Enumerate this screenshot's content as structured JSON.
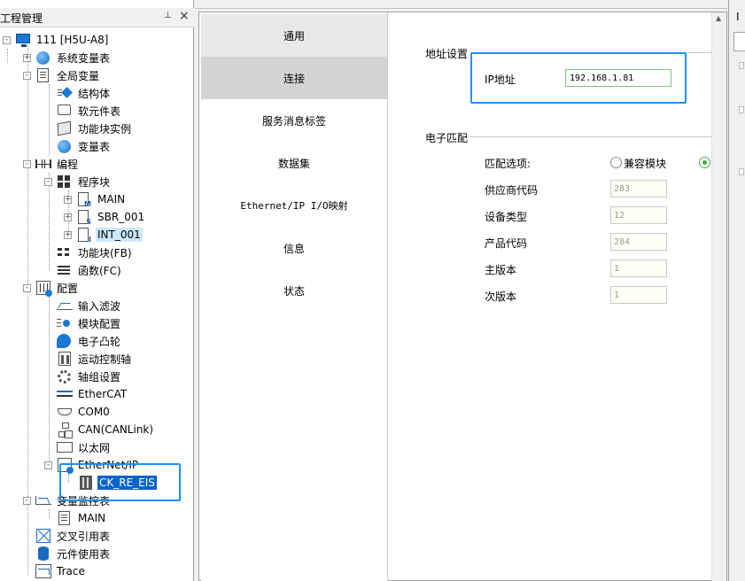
{
  "project_pane": {
    "title": "工程管理",
    "pin_glyph": "⊥",
    "close_glyph": "×"
  },
  "tree": [
    {
      "label": "111 [H5U-A8]",
      "icon": "monitor-icon",
      "expander": "-"
    },
    {
      "label": "系统变量表",
      "icon": "globe-icon",
      "expander": "+"
    },
    {
      "label": "全局变量",
      "icon": "document-icon",
      "expander": "-"
    },
    {
      "label": "结构体",
      "icon": "struct-icon"
    },
    {
      "label": "软元件表",
      "icon": "chat-icon"
    },
    {
      "label": "功能块实例",
      "icon": "box-icon"
    },
    {
      "label": "变量表",
      "icon": "globe-icon"
    },
    {
      "label": "编程",
      "icon": "ladder-icon",
      "expander": "-"
    },
    {
      "label": "程序块",
      "icon": "grid-icon",
      "expander": "-"
    },
    {
      "label": "MAIN",
      "icon": "program-icon",
      "expander": "+"
    },
    {
      "label": "SBR_001",
      "icon": "program-icon",
      "expander": "+"
    },
    {
      "label": "INT_001",
      "icon": "program-icon",
      "expander": "+"
    },
    {
      "label": "功能块(FB)",
      "icon": "function-block-icon"
    },
    {
      "label": "函数(FC)",
      "icon": "function-icon"
    },
    {
      "label": "配置",
      "icon": "config-icon",
      "expander": "-"
    },
    {
      "label": "输入滤波",
      "icon": "wave-icon"
    },
    {
      "label": "模块配置",
      "icon": "module-icon"
    },
    {
      "label": "电子凸轮",
      "icon": "cam-icon"
    },
    {
      "label": "运动控制轴",
      "icon": "axis-icon"
    },
    {
      "label": "轴组设置",
      "icon": "gear-icon"
    },
    {
      "label": "EtherCAT",
      "icon": "ethercat-icon"
    },
    {
      "label": "COM0",
      "icon": "serial-port-icon"
    },
    {
      "label": "CAN(CANLink)",
      "icon": "network-icon"
    },
    {
      "label": "以太网",
      "icon": "ethernet-icon"
    },
    {
      "label": "EtherNet/IP",
      "icon": "ethernet-ip-icon",
      "expander": "-"
    },
    {
      "label": "CK_RE_EIS",
      "icon": "device-icon"
    },
    {
      "label": "变量监控表",
      "icon": "monitor-chart-icon",
      "expander": "-"
    },
    {
      "label": "MAIN",
      "icon": "document-icon"
    },
    {
      "label": "交叉引用表",
      "icon": "cross-reference-icon"
    },
    {
      "label": "元件使用表",
      "icon": "database-icon"
    },
    {
      "label": "Trace",
      "icon": "trace-icon"
    }
  ],
  "nav": [
    {
      "label": "通用"
    },
    {
      "label": "连接"
    },
    {
      "label": "服务消息标签"
    },
    {
      "label": "数据集"
    },
    {
      "label": "Ethernet/IP I/O映射"
    },
    {
      "label": "信息"
    },
    {
      "label": "状态"
    }
  ],
  "address": {
    "title": "地址设置",
    "ip_label": "IP地址",
    "ip_value": "192.168.1.81"
  },
  "matching": {
    "title": "电子匹配",
    "option_label": "匹配选项:",
    "option_compatible": "兼容模块",
    "fields": [
      {
        "label": "供应商代码",
        "value": "283"
      },
      {
        "label": "设备类型",
        "value": "12"
      },
      {
        "label": "产品代码",
        "value": "284"
      },
      {
        "label": "主版本",
        "value": "1"
      },
      {
        "label": "次版本",
        "value": "1"
      }
    ]
  },
  "right_pane": {
    "title": "I"
  },
  "colors": {
    "highlight": "#1e90ff",
    "selected": "#0a64c8",
    "active_nav": "#d3d3d3"
  }
}
